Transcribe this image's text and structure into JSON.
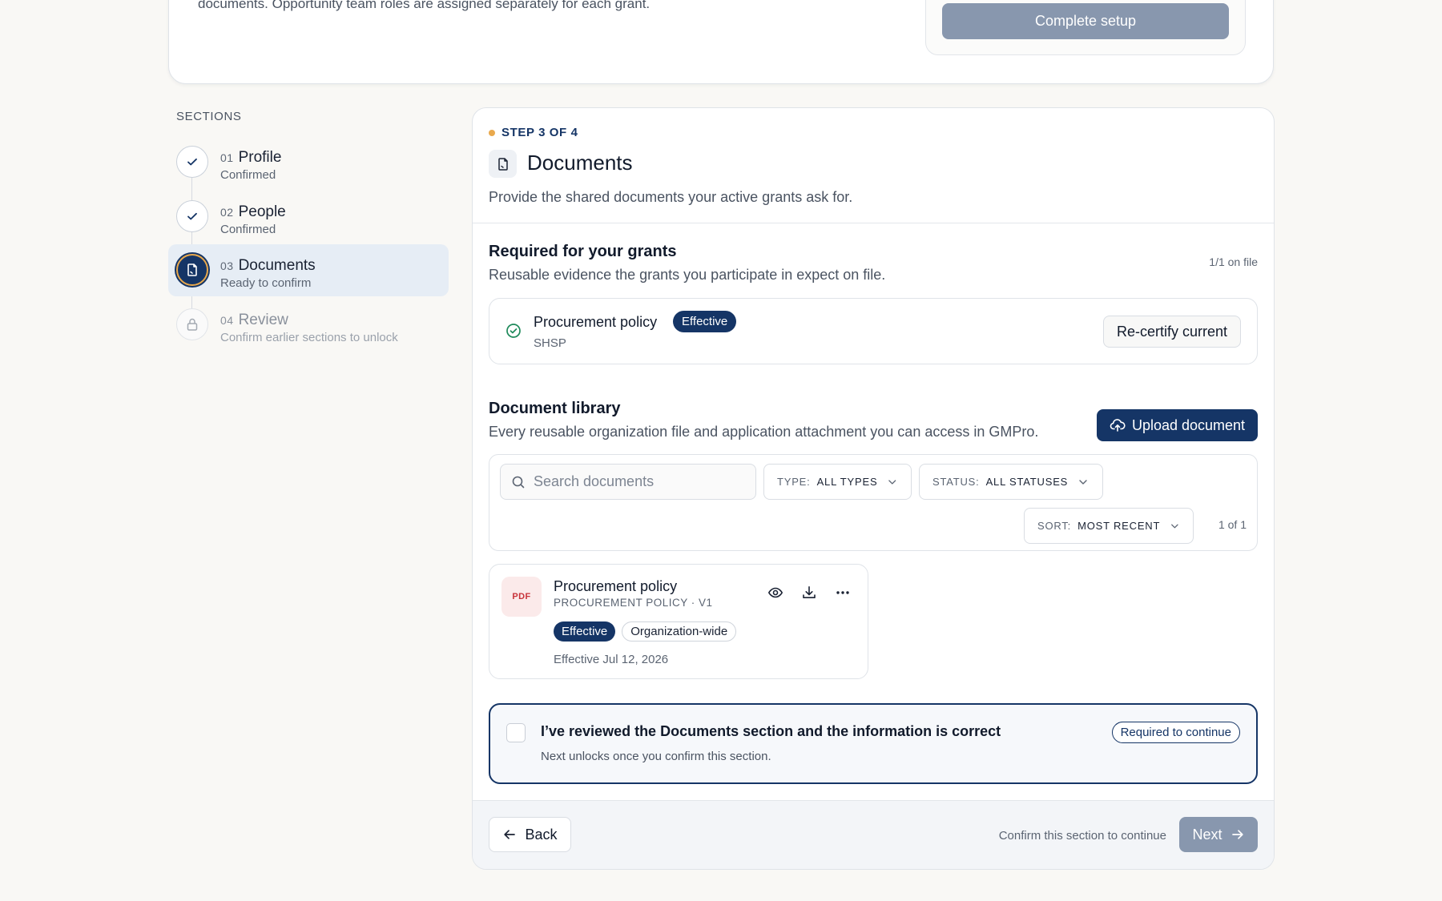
{
  "top_card": {
    "text": "documents. Opportunity team roles are assigned separately for each grant.",
    "complete_setup_label": "Complete setup"
  },
  "sidebar": {
    "heading": "SECTIONS",
    "steps": [
      {
        "num": "01",
        "label": "Profile",
        "status": "Confirmed",
        "icon": "check-icon"
      },
      {
        "num": "02",
        "label": "People",
        "status": "Confirmed",
        "icon": "check-icon"
      },
      {
        "num": "03",
        "label": "Documents",
        "status": "Ready to confirm",
        "icon": "document-icon"
      },
      {
        "num": "04",
        "label": "Review",
        "status": "Confirm earlier sections to unlock",
        "icon": "lock-icon"
      }
    ]
  },
  "main": {
    "step_kicker": "STEP 3 OF 4",
    "title": "Documents",
    "description": "Provide the shared documents your active grants ask for.",
    "required": {
      "title": "Required for your grants",
      "description": "Reusable evidence the grants you participate in expect on file.",
      "count": "1/1 on file",
      "item": {
        "name": "Procurement policy",
        "badge": "Effective",
        "tag": "SHSP",
        "action": "Re-certify current"
      }
    },
    "library": {
      "title": "Document library",
      "description": "Every reusable organization file and application attachment you can access in GMPro.",
      "upload_label": "Upload document",
      "search_placeholder": "Search documents",
      "type_label": "TYPE:",
      "type_value": "ALL TYPES",
      "status_label": "STATUS:",
      "status_value": "ALL STATUSES",
      "sort_label": "SORT:",
      "sort_value": "MOST RECENT",
      "page_count": "1 of 1",
      "documents": [
        {
          "file_type": "PDF",
          "name": "Procurement policy",
          "meta": "PROCUREMENT POLICY · V1",
          "status_badge": "Effective",
          "scope_badge": "Organization-wide",
          "date": "Effective Jul 12, 2026"
        }
      ]
    },
    "confirm": {
      "title": "I’ve reviewed the Documents section and the information is correct",
      "subtitle": "Next unlocks once you confirm this section.",
      "required_label": "Required to continue"
    },
    "footer": {
      "back_label": "Back",
      "hint": "Confirm this section to continue",
      "next_label": "Next"
    }
  },
  "colors": {
    "brand_navy": "#153566",
    "accent_amber": "#e9a94d",
    "disabled_button": "#8897ae",
    "success_green": "#1f8a5b",
    "pdf_red": "#c8333a"
  }
}
